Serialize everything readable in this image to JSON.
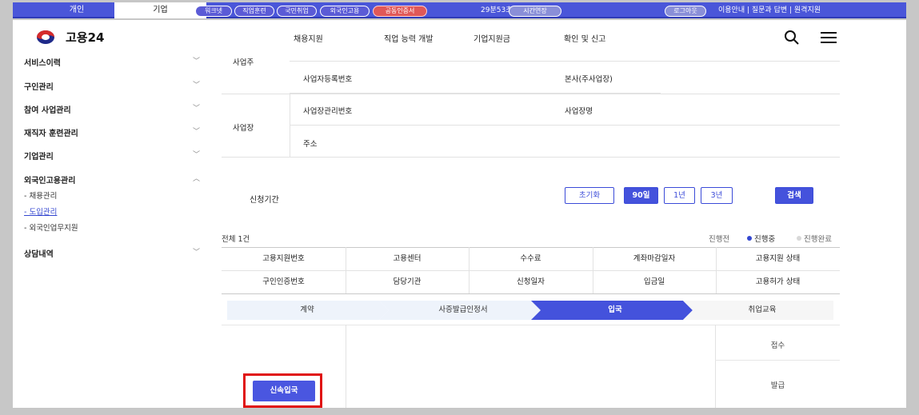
{
  "topbar": {
    "tabs": [
      "개인",
      "기업"
    ],
    "chips": [
      "워크넷",
      "직업훈련",
      "국민취업",
      "외국인고용",
      "공동인증서"
    ],
    "timer": "29분53초",
    "extend_label": "시간연장",
    "logout_label": "로그아웃",
    "links": "이용안내 | 질문과 답변 | 원격지원"
  },
  "header": {
    "logo_text": "고용24",
    "nav": [
      "채용지원",
      "직업 능력 개발",
      "기업지원금",
      "확인 및 신고"
    ]
  },
  "sidebar": {
    "items": [
      "서비스이력",
      "구인관리",
      "참여 사업관리",
      "재직자 훈련관리",
      "기업관리",
      "외국인고용관리",
      "상담내역"
    ],
    "subitems": [
      "- 채용관리",
      "- 도입관리",
      "- 외국인업무지원"
    ]
  },
  "info": {
    "owner_label": "사업주",
    "biz_no": "사업자등록번호",
    "hq": "본사(주사업장)",
    "site_label": "사업장",
    "site_no": "사업장관리번호",
    "site_name": "사업장명",
    "address": "주소"
  },
  "search": {
    "period_label": "신청기간",
    "reset": "초기화",
    "ranges": [
      "90일",
      "1년",
      "3년"
    ],
    "search_btn": "검색"
  },
  "result": {
    "total": "전체 1건",
    "legend": [
      "진행전",
      "진행중",
      "진행완료"
    ]
  },
  "table": {
    "row1": [
      "고용지원번호",
      "고용센터",
      "수수료",
      "계좌마감일자",
      "고용지원 상태"
    ],
    "row2": [
      "구인인증번호",
      "담당기관",
      "신청일자",
      "입금일",
      "고용허가 상태"
    ]
  },
  "steps": [
    "계약",
    "사증발급인정서",
    "입국",
    "취업교육"
  ],
  "status": {
    "received": "접수",
    "issued": "발급"
  },
  "actions": {
    "quick_entry": "신속입국"
  },
  "colors": {
    "brand": "#4452dc",
    "highlight": "#e01111"
  }
}
